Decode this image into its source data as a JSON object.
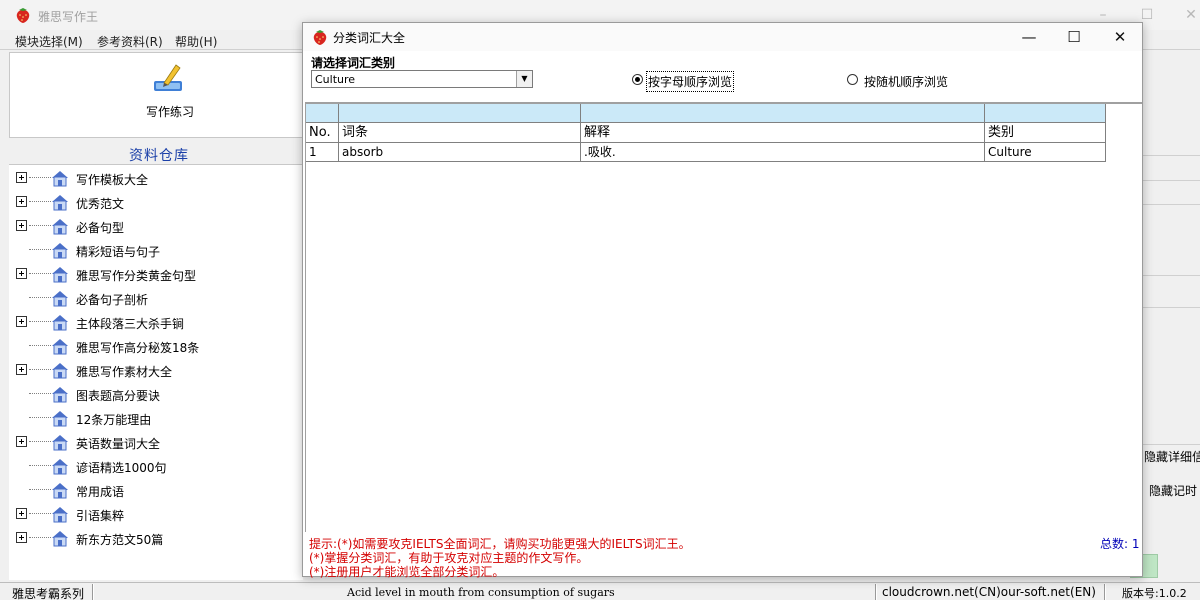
{
  "main_window": {
    "title": "雅思写作王",
    "controls": {
      "minimize": "–",
      "maximize": "☐",
      "close": "✕"
    }
  },
  "menu": [
    {
      "label": "模块选择(M)"
    },
    {
      "label": "参考资料(R)"
    },
    {
      "label": "帮助(H)"
    }
  ],
  "toolbar": {
    "writing_practice_label": "写作练习"
  },
  "repository": {
    "title": "资料仓库",
    "items": [
      {
        "label": "写作模板大全",
        "expandable": true
      },
      {
        "label": "优秀范文",
        "expandable": true
      },
      {
        "label": "必备句型",
        "expandable": true
      },
      {
        "label": "精彩短语与句子",
        "expandable": false
      },
      {
        "label": "雅思写作分类黄金句型",
        "expandable": true
      },
      {
        "label": "必备句子剖析",
        "expandable": false
      },
      {
        "label": "主体段落三大杀手锏",
        "expandable": true
      },
      {
        "label": "雅思写作高分秘笈18条",
        "expandable": false
      },
      {
        "label": "雅思写作素材大全",
        "expandable": true
      },
      {
        "label": "图表题高分要诀",
        "expandable": false
      },
      {
        "label": "12条万能理由",
        "expandable": false
      },
      {
        "label": "英语数量词大全",
        "expandable": true
      },
      {
        "label": "谚语精选1000句",
        "expandable": false
      },
      {
        "label": "常用成语",
        "expandable": false
      },
      {
        "label": "引语集粹",
        "expandable": true
      },
      {
        "label": "新东方范文50篇",
        "expandable": true
      }
    ]
  },
  "right_panel": {
    "hide_details_button": "隐藏详细信息",
    "hide_notes_button": "隐藏记时"
  },
  "status_bar": {
    "series": "雅思考霸系列",
    "message": "Acid level in mouth from consumption of sugars",
    "site": "cloudcrown.net(CN)our-soft.net(EN)",
    "version": "版本号:1.0.2"
  },
  "dialog": {
    "title": "分类词汇大全",
    "controls": {
      "minimize": "—",
      "maximize": "☐",
      "close": "✕"
    },
    "category_label": "请选择词汇类别",
    "category_selected": "Culture",
    "radio_alpha": {
      "label": "按字母顺序浏览",
      "checked": true
    },
    "radio_random": {
      "label": "按随机顺序浏览",
      "checked": false
    },
    "table": {
      "headers": {
        "no": "No.",
        "entry": "词条",
        "meaning": "解释",
        "category": "类别"
      },
      "rows": [
        {
          "no": "1",
          "entry": "absorb",
          "meaning": ".吸收.",
          "category": "Culture"
        }
      ]
    },
    "hints": [
      "提示:(*)如需要攻克IELTS全面词汇，请购买功能更强大的IELTS词汇王。",
      "(*)掌握分类词汇，有助于攻克对应主题的作文写作。",
      "(*)注册用户才能浏览全部分类词汇。"
    ],
    "total": "总数: 1"
  },
  "colors": {
    "grid_header_band": "#cbe9f8",
    "hint_text": "#d40000",
    "total_text": "#0000b8",
    "repository_title": "#1a3fa8"
  },
  "icons": {
    "app": "strawberry-icon",
    "writing": "pen-paper-icon",
    "tree_item": "house-icon"
  }
}
